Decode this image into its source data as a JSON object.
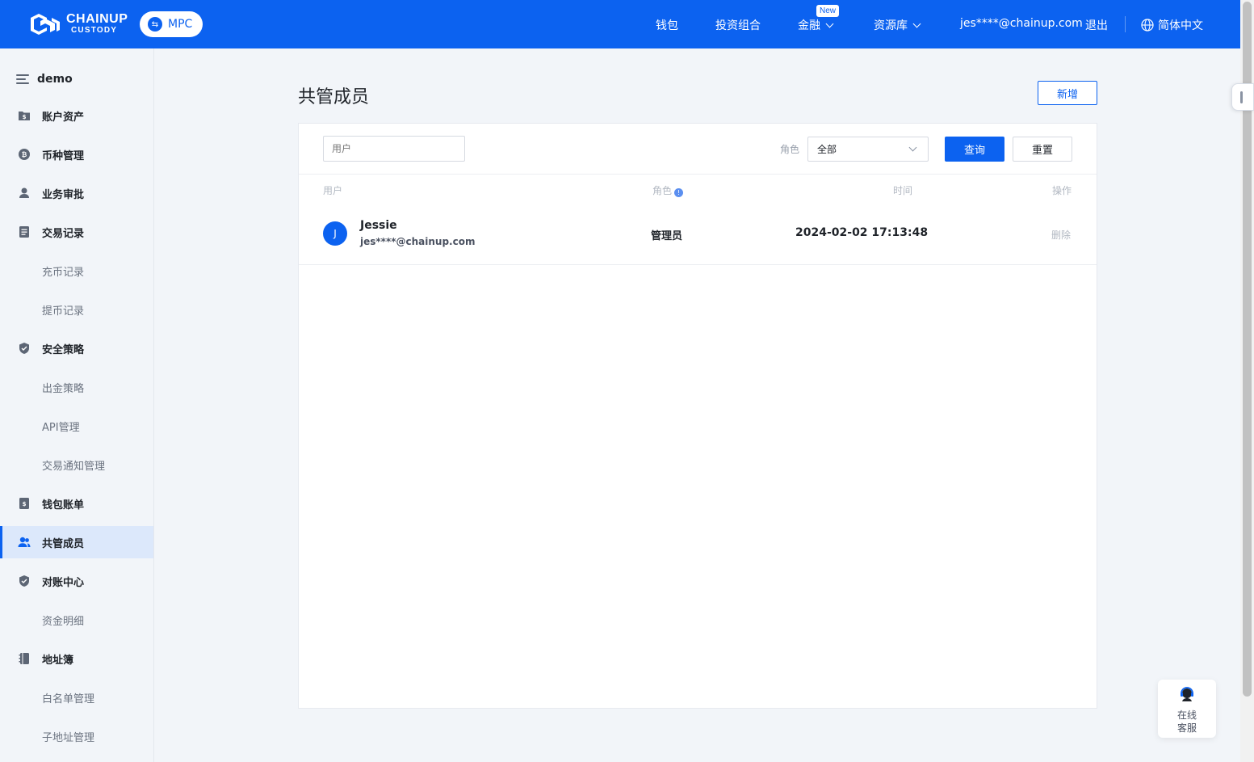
{
  "header": {
    "logo_line1": "CHAINUP",
    "logo_line2": "CUSTODY",
    "mpc_label": "MPC",
    "nav": {
      "wallet": "钱包",
      "portfolio": "投资组合",
      "finance": "金融",
      "finance_badge": "New",
      "resources": "资源库",
      "user_email": "jes****@chainup.com",
      "logout": "退出",
      "language": "简体中文"
    },
    "colors": {
      "brand": "#0c62f0"
    }
  },
  "sidebar": {
    "title": "demo",
    "items": [
      {
        "label": "账户资产",
        "icon": "folder-dollar-icon"
      },
      {
        "label": "币种管理",
        "icon": "bitcoin-coin-icon"
      },
      {
        "label": "业务审批",
        "icon": "person-approve-icon"
      },
      {
        "label": "交易记录",
        "icon": "document-list-icon"
      },
      {
        "label": "充币记录"
      },
      {
        "label": "提币记录"
      },
      {
        "label": "安全策略",
        "icon": "shield-check-icon"
      },
      {
        "label": "出金策略"
      },
      {
        "label": "API管理"
      },
      {
        "label": "交易通知管理"
      },
      {
        "label": "钱包账单",
        "icon": "wallet-bill-icon"
      },
      {
        "label": "共管成员",
        "icon": "users-icon"
      },
      {
        "label": "对账中心",
        "icon": "shield-check-icon"
      },
      {
        "label": "资金明细"
      },
      {
        "label": "地址簿",
        "icon": "address-book-icon"
      },
      {
        "label": "白名单管理"
      },
      {
        "label": "子地址管理"
      }
    ]
  },
  "main": {
    "title": "共管成员",
    "add_button": "新增",
    "filters": {
      "user_placeholder": "用户",
      "role_label": "角色",
      "role_value": "全部",
      "query_button": "查询",
      "reset_button": "重置"
    },
    "table": {
      "columns": {
        "user": "用户",
        "role": "角色",
        "time": "时间",
        "action": "操作"
      },
      "rows": [
        {
          "avatar": "J",
          "name": "Jessie",
          "email": "jes****@chainup.com",
          "role": "管理员",
          "time": "2024-02-02 17:13:48",
          "action": "删除"
        }
      ]
    }
  },
  "support": {
    "line1": "在线",
    "line2": "客服"
  }
}
